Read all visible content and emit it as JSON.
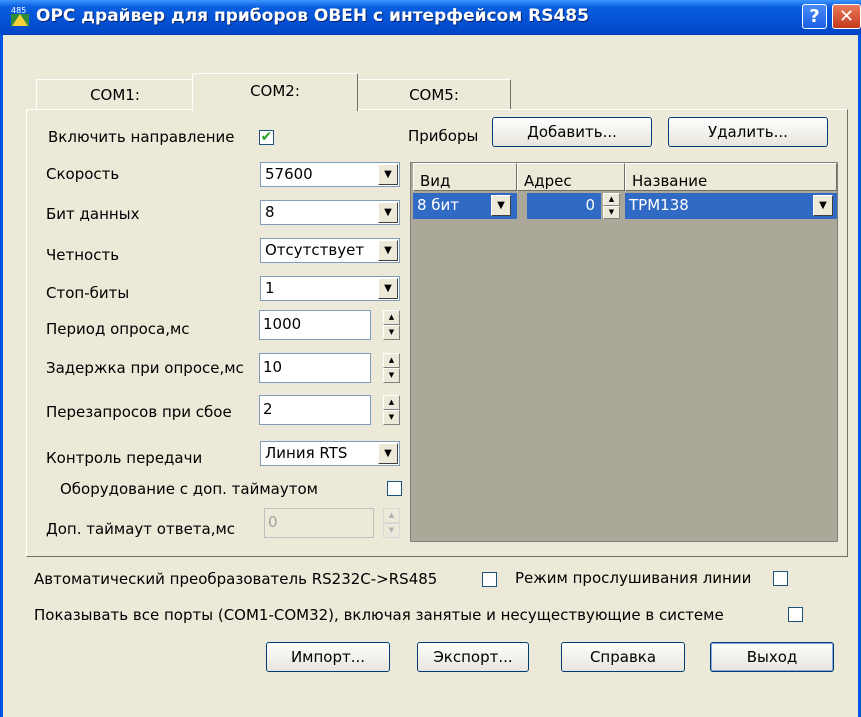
{
  "window": {
    "title": "OPC драйвер для приборов ОВЕН с интерфейсом RS485",
    "icon_text": "485",
    "help_label": "?",
    "close_label": "✕"
  },
  "tabs": [
    {
      "label": "COM1:",
      "active": false
    },
    {
      "label": "COM2:",
      "active": true
    },
    {
      "label": "COM5:",
      "active": false
    }
  ],
  "settings": {
    "enable_direction_label": "Включить направление",
    "enable_direction_checked": true,
    "speed_label": "Скорость",
    "speed_value": "57600",
    "data_bits_label": "Бит данных",
    "data_bits_value": "8",
    "parity_label": "Четность",
    "parity_value": "Отсутствует",
    "stop_bits_label": "Стоп-биты",
    "stop_bits_value": "1",
    "poll_period_label": "Период опроса,мс",
    "poll_period_value": "1000",
    "poll_delay_label": "Задержка при опросе,мс",
    "poll_delay_value": "10",
    "retries_label": "Перезапросов при сбое",
    "retries_value": "2",
    "flow_control_label": "Контроль передачи",
    "flow_control_value": "Линия RTS",
    "extra_timeout_device_label": "Оборудование с доп. таймаутом",
    "extra_timeout_label": "Доп. таймаут ответа,мс",
    "extra_timeout_value": "0"
  },
  "devices": {
    "label": "Приборы",
    "add_label": "Добавить...",
    "delete_label": "Удалить...",
    "columns": [
      "Вид",
      "Адрес",
      "Название"
    ],
    "rows": [
      {
        "type": "8 бит",
        "address": "0",
        "name": "ТРМ138"
      }
    ]
  },
  "options": {
    "auto_converter_label": "Автоматический преобразователь RS232C->RS485",
    "listen_mode_label": "Режим прослушивания линии",
    "show_all_ports_label": "Показывать все порты (COM1-COM32), включая занятые и несуществующие в системе"
  },
  "buttons": {
    "import": "Импорт...",
    "export": "Экспорт...",
    "help": "Справка",
    "exit": "Выход"
  },
  "icons": {
    "dropdown": "▼",
    "spin_up": "▲",
    "spin_down": "▼",
    "check": "✔"
  }
}
